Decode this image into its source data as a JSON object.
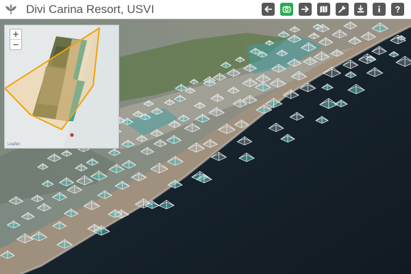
{
  "app": {
    "title": "Divi Carina Resort, USVI",
    "logo_icon": "leaf-logo-icon"
  },
  "toolbar": {
    "buttons": [
      {
        "name": "back",
        "icon": "arrow-left-icon",
        "active": false
      },
      {
        "name": "camera",
        "icon": "camera-icon",
        "active": true
      },
      {
        "name": "forward",
        "icon": "arrow-right-icon",
        "active": false
      },
      {
        "name": "map",
        "icon": "map-icon",
        "active": false
      },
      {
        "name": "tools",
        "icon": "wrench-icon",
        "active": false
      },
      {
        "name": "download",
        "icon": "download-icon",
        "active": false
      },
      {
        "name": "info",
        "icon": "info-icon",
        "active": false
      },
      {
        "name": "help",
        "icon": "help-icon",
        "active": false
      }
    ]
  },
  "minimap": {
    "zoom_in": "+",
    "zoom_out": "−",
    "attribution": "Leaflet"
  },
  "colors": {
    "header_bg": "#ffffff",
    "title_text": "#555555",
    "button_bg": "#58585a",
    "active_button_bg": "#2eaa53",
    "footprint_stroke": "#f0a30a",
    "footprint_fill": "#f5c26b",
    "camera_marker": "#c0392b",
    "ocean": "#15202a"
  }
}
